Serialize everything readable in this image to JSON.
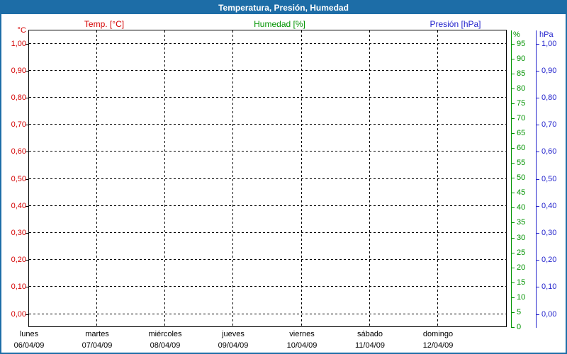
{
  "window": {
    "title": "Temperatura, Presión, Humedad"
  },
  "colors": {
    "titlebar_bg": "#1d6da7",
    "window_border": "#1d6da7",
    "title_text": "#ffffff",
    "temp": "#d40000",
    "humidity": "#009300",
    "pressure": "#2222cc",
    "grid": "#000000",
    "plot_border": "#000000",
    "plot_bg": "#ffffff",
    "day_text": "#000000"
  },
  "legend": {
    "temp_label": "Temp. [°C]",
    "humidity_label": "Humedad [%]",
    "pressure_label": "Presión [hPa]"
  },
  "chart_data": {
    "type": "line",
    "title": "Temperatura, Presión, Humedad",
    "grid": true,
    "legend_position": "top",
    "note": "Plot area is empty — no data points are drawn for any of the three series; only axes and gridlines are visible.",
    "series": [
      {
        "name": "Temp. [°C]",
        "axis": "temp",
        "color": "#d40000",
        "values": []
      },
      {
        "name": "Humedad [%]",
        "axis": "humidity",
        "color": "#009300",
        "values": []
      },
      {
        "name": "Presión [hPa]",
        "axis": "pressure",
        "color": "#2222cc",
        "values": []
      }
    ],
    "axes": {
      "temp": {
        "side": "left",
        "unit": "°C",
        "min": 0.0,
        "max": 1.0,
        "step": 0.1,
        "tick_labels": [
          "1,00",
          "0,90",
          "0,80",
          "0,70",
          "0,60",
          "0,50",
          "0,40",
          "0,30",
          "0,20",
          "0,10",
          "0,00"
        ]
      },
      "humidity": {
        "side": "right",
        "unit": "%",
        "min": 0,
        "max": 95,
        "step": 5,
        "tick_labels": [
          "95",
          "90",
          "85",
          "80",
          "75",
          "70",
          "65",
          "60",
          "55",
          "50",
          "45",
          "40",
          "35",
          "30",
          "25",
          "20",
          "15",
          "10",
          "5",
          "0"
        ]
      },
      "pressure": {
        "side": "far-right",
        "unit": "hPa",
        "min": 0.0,
        "max": 1.0,
        "step": 0.1,
        "tick_labels": [
          "1,00",
          "0,90",
          "0,80",
          "0,70",
          "0,60",
          "0,50",
          "0,40",
          "0,30",
          "0,20",
          "0,10",
          "0,00"
        ]
      },
      "x": {
        "side": "bottom",
        "days": [
          {
            "name": "lunes",
            "date": "06/04/09"
          },
          {
            "name": "martes",
            "date": "07/04/09"
          },
          {
            "name": "miércoles",
            "date": "08/04/09"
          },
          {
            "name": "jueves",
            "date": "09/04/09"
          },
          {
            "name": "viernes",
            "date": "10/04/09"
          },
          {
            "name": "sábado",
            "date": "11/04/09"
          },
          {
            "name": "domingo",
            "date": "12/04/09"
          }
        ]
      }
    }
  }
}
